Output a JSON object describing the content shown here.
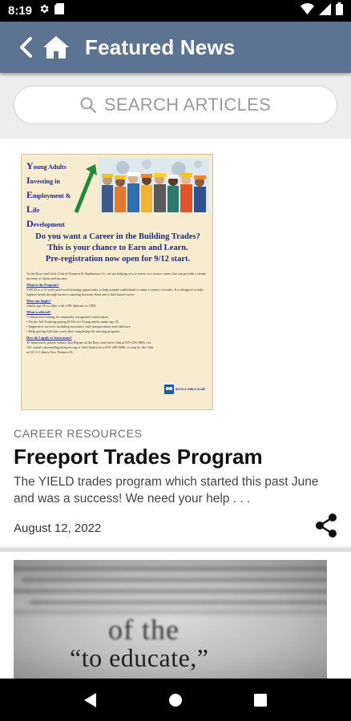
{
  "status_bar": {
    "time": "8:19",
    "left_icons": [
      "gear-icon",
      "sd-card-icon"
    ],
    "right_icons": [
      "wifi-icon",
      "signal-icon",
      "battery-icon"
    ]
  },
  "app_bar": {
    "title": "Featured News",
    "background_color": "#5c7491",
    "icons": [
      "back-arrow-icon",
      "home-icon"
    ]
  },
  "search": {
    "placeholder": "SEARCH ARTICLES",
    "icon": "search-icon"
  },
  "articles": [
    {
      "flyer": {
        "acronym_lines": [
          {
            "initial": "Y",
            "rest": "oung Adults"
          },
          {
            "initial": "I",
            "rest": "nvesting in"
          },
          {
            "initial": "E",
            "rest": "mployment &"
          },
          {
            "initial": "L",
            "rest": "ife"
          },
          {
            "initial": "D",
            "rest": "evelopment"
          }
        ],
        "headline_lines": [
          "Do you want a Career in the Building Trades?",
          "This is your chance to Earn and Learn.",
          "Pre-registration now open for 9/12 start."
        ],
        "body_intro": "At the Boys and Girls Club of Freeport & Stephenson Co. we are helping you to invest in a secure career that can provide a steady increase of talent and income.",
        "q1_heading": "What is the Program?",
        "q1_text": "YIELD is a 12 week paid work/training opportunity to help prepare individuals to enter a variety of trades. It is designed to help fighters break through barriers standing between them and a skill based career.",
        "q2_heading": "Who can Apply?",
        "q2_text": "Adults age 18 or older with a HS diploma or GED.",
        "q3_heading": "What is offered?",
        "offered_items": [
          "Classroom training for nationally recognized certification.",
          "On the Job Training paying $15/hr for Young adults under age 25.",
          "Supportive services including assistance with transportation and childcare.",
          "Help getting full-time work after completing the training program."
        ],
        "q4_heading": "How do I apply or learn more?",
        "contact_text": "To learn more, please contact Jim Rhyme at the Boys and Girls Club at 815-233-1800, ext. 125, email: jrhyme@bgcfreeport.org or Ted Chadwick at 815-289-8800, or stop by the Club at 311 S. Liberty Ave, Freeport IL",
        "logo_text": "BOYS & GIRLS CLUB"
      },
      "category": "CAREER RESOURCES",
      "title": "Freeport Trades Program",
      "summary": "The YIELD trades program which started this past June and was a success!   We need your help . . .",
      "date": "August 12, 2022",
      "share_icon": "share-icon"
    },
    {
      "image_words": {
        "line1": "of the",
        "line2": "“to educate,”"
      }
    }
  ],
  "nav_bar": {
    "icons": [
      "back-triangle-icon",
      "home-circle-icon",
      "recents-square-icon"
    ]
  }
}
